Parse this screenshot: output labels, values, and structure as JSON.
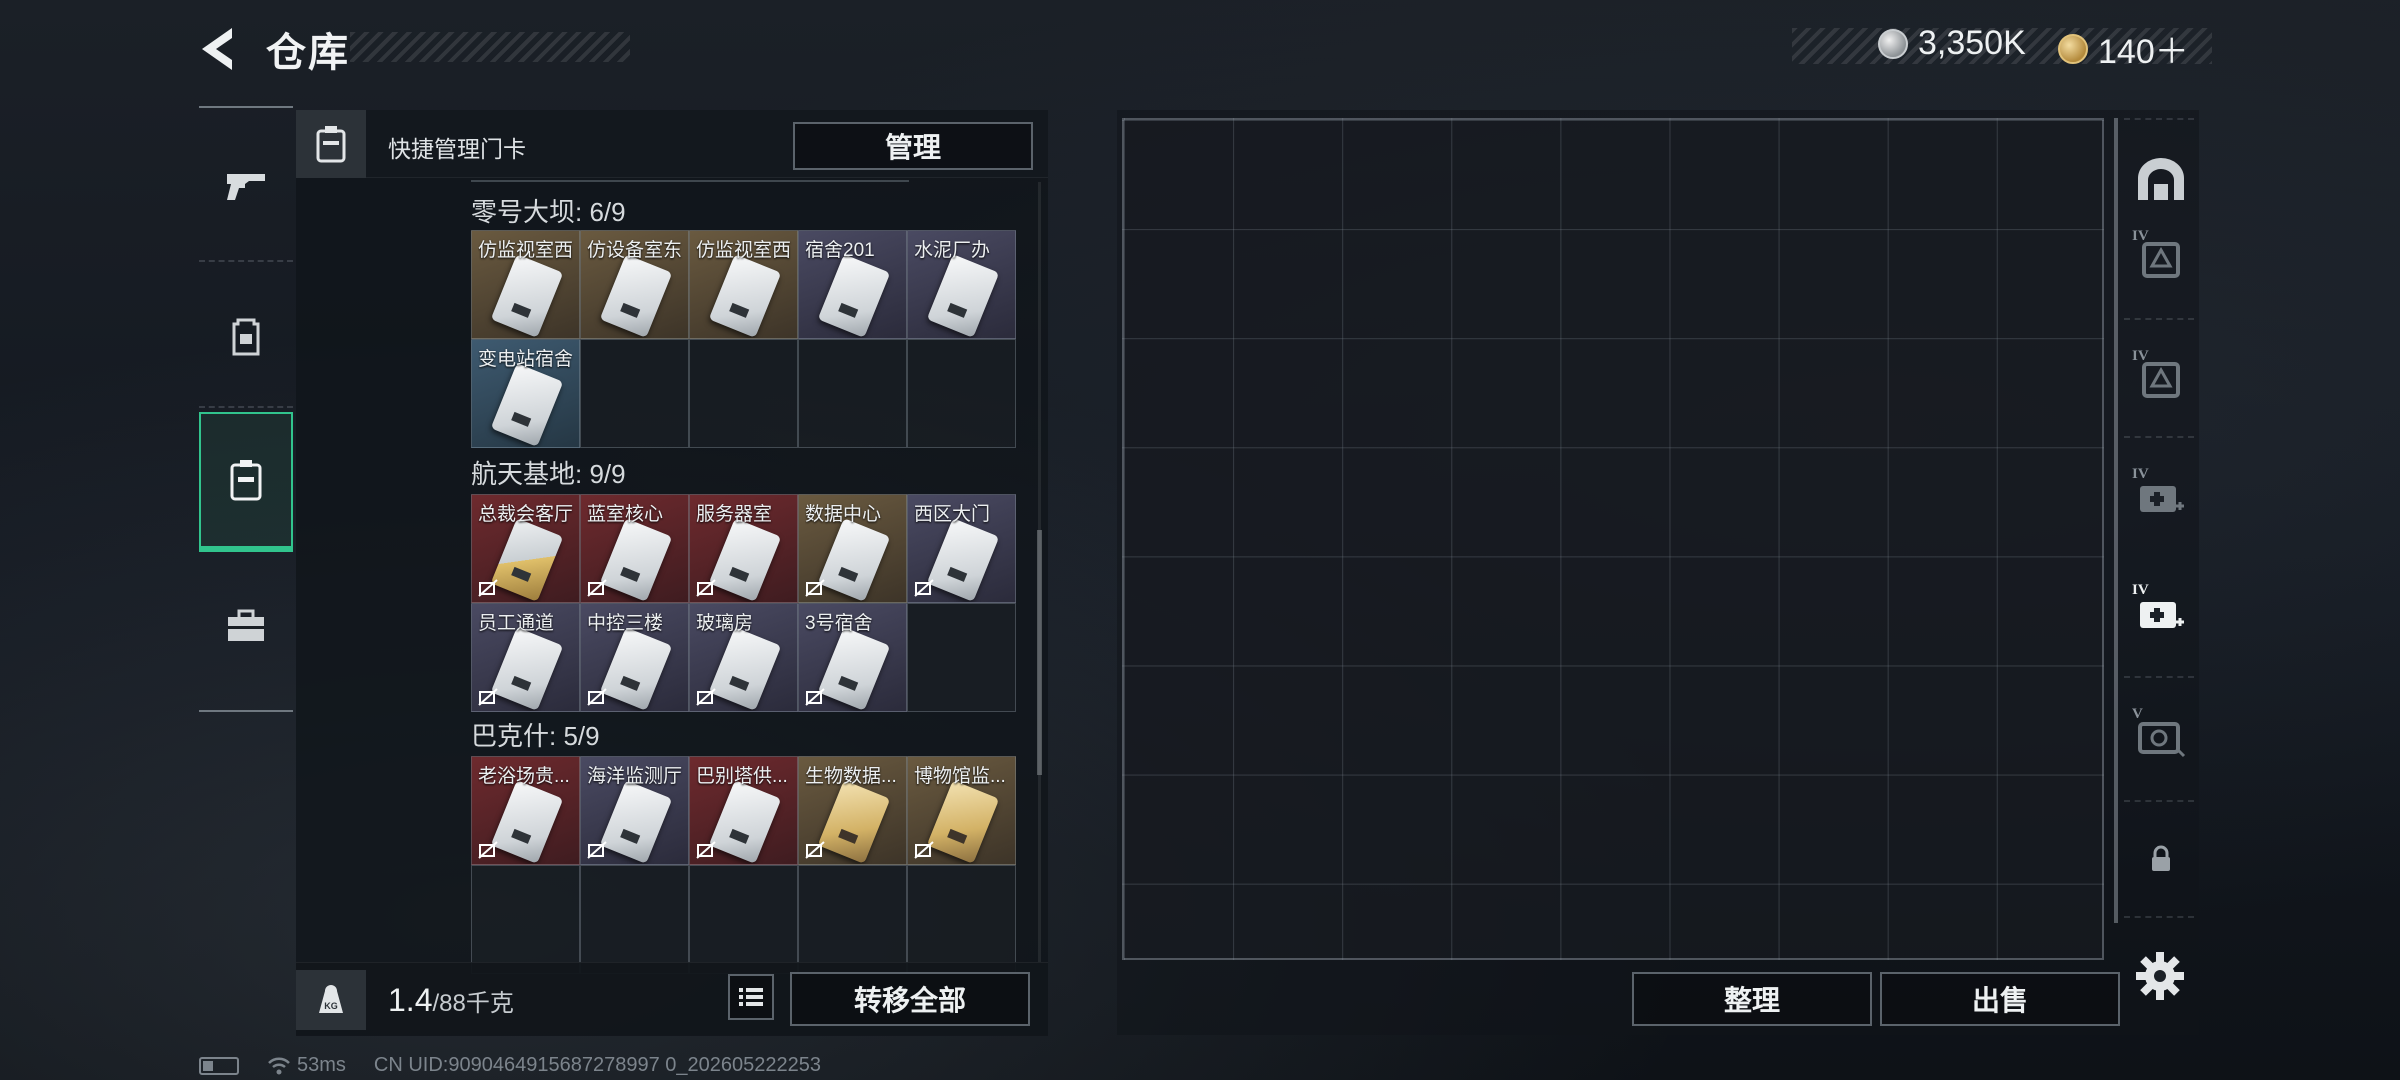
{
  "header": {
    "title": "仓库",
    "silver": "3,350K",
    "gold": "140＋"
  },
  "left_nav": {
    "items": [
      {
        "icon": "gun-icon"
      },
      {
        "icon": "backpack-icon"
      },
      {
        "icon": "keycard-case-icon",
        "active": true
      },
      {
        "icon": "toolbox-icon"
      }
    ]
  },
  "quick": {
    "label": "快捷管理门卡",
    "manage_label": "管理"
  },
  "sections": [
    {
      "title": "零号大坝: 6/9",
      "cards": [
        {
          "name": "仿监视室西",
          "rarity": "gold"
        },
        {
          "name": "仿设备室东",
          "rarity": "gold"
        },
        {
          "name": "仿监视室西",
          "rarity": "gold"
        },
        {
          "name": "宿舍201",
          "rarity": "purple"
        },
        {
          "name": "水泥厂办",
          "rarity": "purple"
        },
        {
          "name": "变电站宿舍",
          "rarity": "blue"
        }
      ]
    },
    {
      "title": "航天基地: 9/9",
      "cards": [
        {
          "name": "总裁会客厅",
          "rarity": "red"
        },
        {
          "name": "蓝室核心",
          "rarity": "red"
        },
        {
          "name": "服务器室",
          "rarity": "red"
        },
        {
          "name": "数据中心",
          "rarity": "gold"
        },
        {
          "name": "西区大门",
          "rarity": "purple"
        },
        {
          "name": "员工通道",
          "rarity": "purple"
        },
        {
          "name": "中控三楼",
          "rarity": "purple"
        },
        {
          "name": "玻璃房",
          "rarity": "purple"
        },
        {
          "name": "3号宿舍",
          "rarity": "purple"
        }
      ]
    },
    {
      "title": "巴克什: 5/9",
      "cards": [
        {
          "name": "老浴场贵...",
          "rarity": "red"
        },
        {
          "name": "海洋监测厅",
          "rarity": "purple"
        },
        {
          "name": "巴别塔供...",
          "rarity": "red"
        },
        {
          "name": "生物数据...",
          "rarity": "gold"
        },
        {
          "name": "博物馆监...",
          "rarity": "gold"
        }
      ]
    }
  ],
  "bottom": {
    "weight_current": "1.4",
    "weight_max": "/88千克",
    "weight_icon_text": "KG",
    "transfer_label": "转移全部"
  },
  "storage": {
    "tidy_label": "整理",
    "sell_label": "出售",
    "side_tiers": [
      "",
      "IV",
      "IV",
      "IV",
      "IV",
      "V",
      "",
      ""
    ]
  },
  "status": {
    "ping": "53ms",
    "uid": "CN UID:9090464915687278997 0_202605222253"
  },
  "colors": {
    "accent": "#31c48d",
    "rarity_gold": "#6a5a40",
    "rarity_purple": "#4a4a62",
    "rarity_blue": "#3e5a70",
    "rarity_red": "#6e2a2e"
  }
}
